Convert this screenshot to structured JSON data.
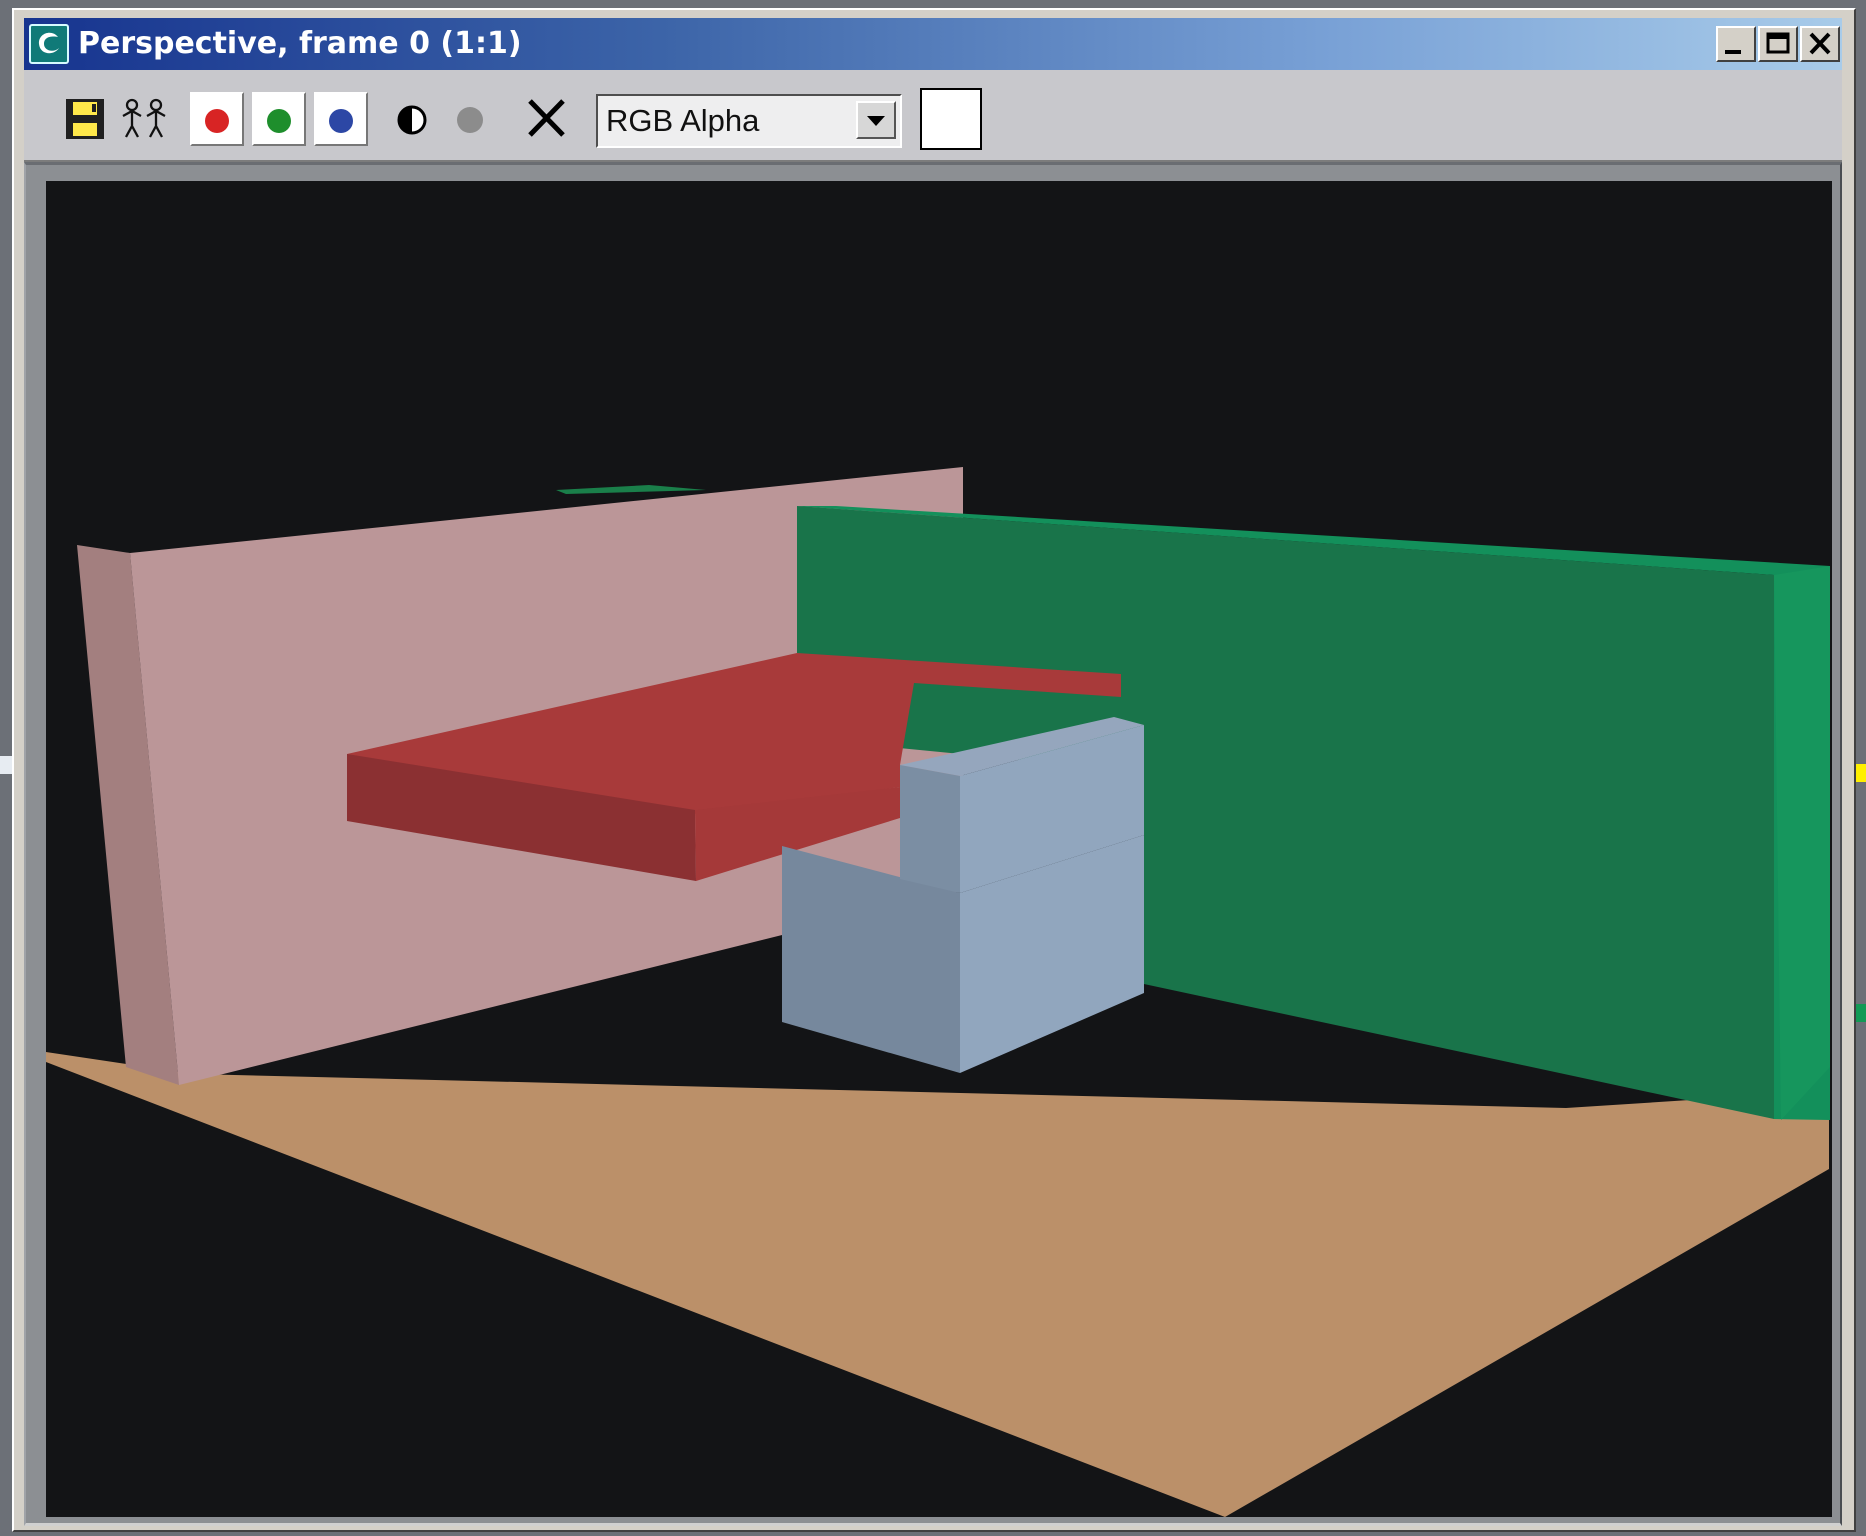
{
  "window": {
    "title": "Perspective, frame 0 (1:1)"
  },
  "toolbar": {
    "selected_channel_display": "RGB Alpha",
    "swatch_color": "#ffffff"
  },
  "icons": [
    "app-icon",
    "minimize-icon",
    "maximize-icon",
    "close-icon",
    "save-icon",
    "clone-icon",
    "red-channel-icon",
    "green-channel-icon",
    "blue-channel-icon",
    "monochrome-icon",
    "alpha-channel-icon",
    "clear-icon",
    "dropdown-arrow-icon"
  ],
  "colors": {
    "window_bg": "#d4d0c8",
    "title_start": "#17348f",
    "title_end": "#a8cbe9",
    "render_bg": "#131416",
    "floor": "#bb9069",
    "pink_wall": "#bb9698",
    "green_wall": "#19744a",
    "red_slab": "#a83a3a",
    "blue_box": "#91a6be"
  }
}
